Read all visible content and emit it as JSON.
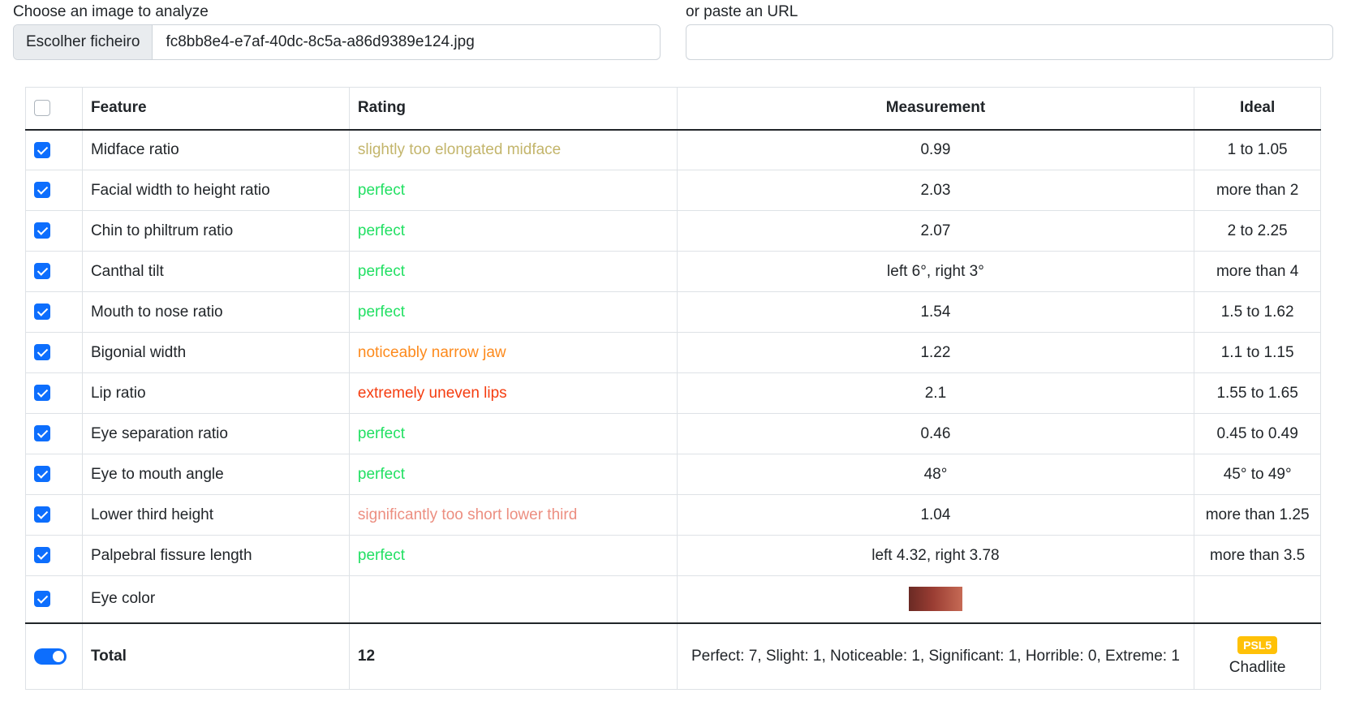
{
  "upload": {
    "label": "Choose an image to analyze",
    "button_label": "Escolher ficheiro",
    "file_name": "fc8bb8e4-e7af-40dc-8c5a-a86d9389e124.jpg"
  },
  "url": {
    "label": "or paste an URL",
    "value": ""
  },
  "table": {
    "headers": {
      "feature": "Feature",
      "rating": "Rating",
      "measurement": "Measurement",
      "ideal": "Ideal"
    },
    "rows": [
      {
        "feature": "Midface ratio",
        "rating": "slightly too elongated midface",
        "rating_color": "#c3b56b",
        "measurement": "0.99",
        "ideal": "1 to 1.05",
        "checked": true
      },
      {
        "feature": "Facial width to height ratio",
        "rating": "perfect",
        "rating_color": "#22e063",
        "measurement": "2.03",
        "ideal": "more than 2",
        "checked": true
      },
      {
        "feature": "Chin to philtrum ratio",
        "rating": "perfect",
        "rating_color": "#22e063",
        "measurement": "2.07",
        "ideal": "2 to 2.25",
        "checked": true
      },
      {
        "feature": "Canthal tilt",
        "rating": "perfect",
        "rating_color": "#22e063",
        "measurement": "left 6°, right 3°",
        "ideal": "more than 4",
        "checked": true
      },
      {
        "feature": "Mouth to nose ratio",
        "rating": "perfect",
        "rating_color": "#22e063",
        "measurement": "1.54",
        "ideal": "1.5 to 1.62",
        "checked": true
      },
      {
        "feature": "Bigonial width",
        "rating": "noticeably narrow jaw",
        "rating_color": "#fd8a1c",
        "measurement": "1.22",
        "ideal": "1.1 to 1.15",
        "checked": true
      },
      {
        "feature": "Lip ratio",
        "rating": "extremely uneven lips",
        "rating_color": "#f53d10",
        "measurement": "2.1",
        "ideal": "1.55 to 1.65",
        "checked": true
      },
      {
        "feature": "Eye separation ratio",
        "rating": "perfect",
        "rating_color": "#22e063",
        "measurement": "0.46",
        "ideal": "0.45 to 0.49",
        "checked": true
      },
      {
        "feature": "Eye to mouth angle",
        "rating": "perfect",
        "rating_color": "#22e063",
        "measurement": "48°",
        "ideal": "45° to 49°",
        "checked": true
      },
      {
        "feature": "Lower third height",
        "rating": "significantly too short lower third",
        "rating_color": "#ec8e80",
        "measurement": "1.04",
        "ideal": "more than 1.25",
        "checked": true
      },
      {
        "feature": "Palpebral fissure length",
        "rating": "perfect",
        "rating_color": "#22e063",
        "measurement": "left 4.32, right 3.78",
        "ideal": "more than 3.5",
        "checked": true
      }
    ],
    "eye_color": {
      "feature": "Eye color",
      "checked": true
    },
    "total": {
      "label": "Total",
      "count": "12",
      "summary": "Perfect: 7, Slight: 1, Noticeable: 1, Significant: 1, Horrible: 0, Extreme: 1",
      "badge": "PSL5",
      "badge_color": "#ffc107",
      "psl_name": "Chadlite"
    }
  }
}
